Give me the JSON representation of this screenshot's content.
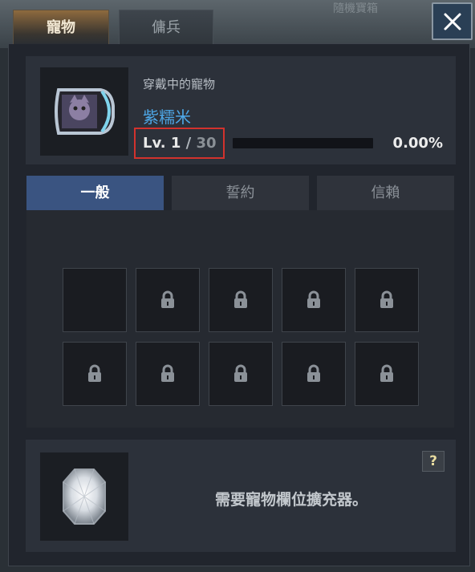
{
  "background": {
    "title": "隨機寶箱"
  },
  "tabs": [
    {
      "label": "寵物",
      "active": true
    },
    {
      "label": "傭兵",
      "active": false
    }
  ],
  "close_icon": "close-icon",
  "pet": {
    "equipped_label": "穿戴中的寵物",
    "name": "紫糯米",
    "level_prefix": "Lv.",
    "level": "1",
    "level_separator": "/",
    "level_max": "30",
    "exp_percent_text": "0.00%",
    "exp_fraction": 0.0
  },
  "subtabs": [
    {
      "label": "一般",
      "active": true
    },
    {
      "label": "誓約",
      "active": false
    },
    {
      "label": "信賴",
      "active": false
    }
  ],
  "slots": {
    "unlocked_count": 1,
    "locked_count": 9,
    "lock_icon": "lock-icon"
  },
  "footer": {
    "help_label": "?",
    "message": "需要寵物欄位擴充器。"
  },
  "colors": {
    "accent_blue": "#4ea8e8",
    "active_subtab": "#3a5481",
    "highlight_red": "#d2322d"
  }
}
